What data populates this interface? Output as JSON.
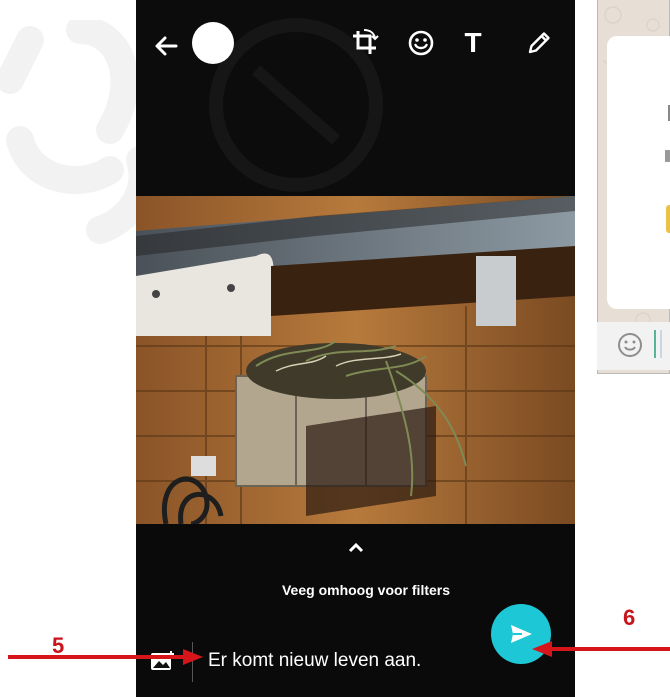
{
  "swipe_hint": "Veeg omhoog voor filters",
  "caption_text": "Er komt nieuw leven aan.",
  "annotations": {
    "label5": "5",
    "label6": "6"
  },
  "icons": {
    "back": "arrow-left-icon",
    "crop": "crop-rotate-icon",
    "emoji": "emoji-icon",
    "text": "T",
    "pencil": "pencil-icon",
    "gallery": "add-image-icon",
    "send": "send-icon",
    "chevron": "chevron-up-icon"
  },
  "colors": {
    "send_button": "#1ec7d6",
    "annotation": "#c8151b"
  }
}
